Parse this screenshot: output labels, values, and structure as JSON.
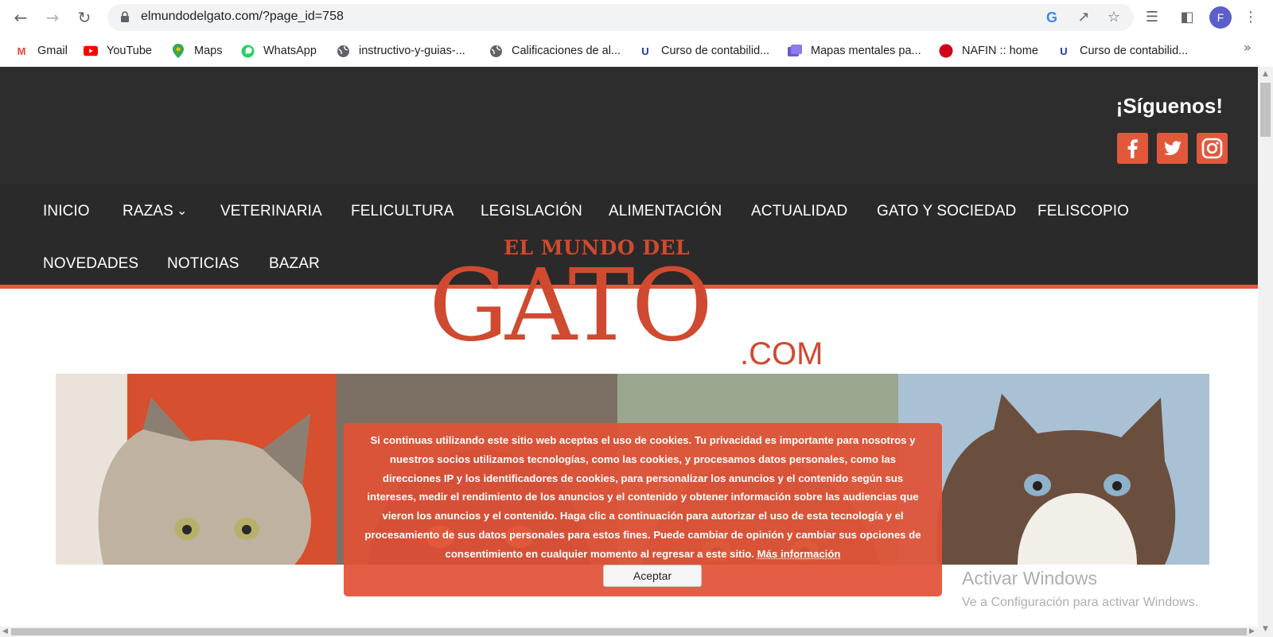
{
  "browser": {
    "url": "elmundodelgato.com/?page_id=758",
    "avatar_letter": "F",
    "bookmarks": [
      {
        "label": "Gmail",
        "icon": "gmail-icon"
      },
      {
        "label": "YouTube",
        "icon": "youtube-icon"
      },
      {
        "label": "Maps",
        "icon": "maps-icon"
      },
      {
        "label": "WhatsApp",
        "icon": "whatsapp-icon"
      },
      {
        "label": "instructivo-y-guias-...",
        "icon": "globe-icon"
      },
      {
        "label": "Calificaciones de al...",
        "icon": "globe-icon"
      },
      {
        "label": "Curso de contabilid...",
        "icon": "u-icon"
      },
      {
        "label": "Mapas mentales pa...",
        "icon": "slides-icon"
      },
      {
        "label": "NAFIN :: home",
        "icon": "nafin-icon"
      },
      {
        "label": "Curso de contabilid...",
        "icon": "u-icon"
      }
    ],
    "more": "»"
  },
  "site": {
    "follow_label": "¡Síguenos!",
    "social": [
      "facebook-icon",
      "twitter-icon",
      "instagram-icon"
    ],
    "nav": {
      "row1": [
        "INICIO",
        "RAZAS",
        "VETERINARIA",
        "FELICULTURA",
        "LEGISLACIÓN",
        "ALIMENTACIÓN",
        "ACTUALIDAD",
        "GATO Y SOCIEDAD",
        "FELISCOPIO"
      ],
      "row2": [
        "NOVEDADES",
        "NOTICIAS",
        "BAZAR"
      ]
    },
    "logo": {
      "top": "EL MUNDO DEL",
      "main": "GATO",
      "suffix": ".COM"
    }
  },
  "cookie": {
    "text": "Si continuas utilizando este sitio web aceptas el uso de cookies. Tu privacidad es importante para nosotros y nuestros socios utilizamos tecnologías, como las cookies, y procesamos datos personales, como las direcciones IP y los identificadores de cookies, para personalizar los anuncios y el contenido según sus intereses, medir el rendimiento de los anuncios y el contenido y obtener información sobre las audiencias que vieron los anuncios y el contenido. Haga clic a continuación para autorizar el uso de esta tecnología y el procesamiento de sus datos personales para estos fines. Puede cambiar de opinión y cambiar sus opciones de consentimiento en cualquier momento al regresar a este sitio.",
    "link": "Más información",
    "accept": "Aceptar"
  },
  "watermark": {
    "title": "Activar Windows",
    "subtitle": "Ve a Configuración para activar Windows."
  },
  "colors": {
    "accent": "#e2583b",
    "header": "#2d2d2d"
  }
}
